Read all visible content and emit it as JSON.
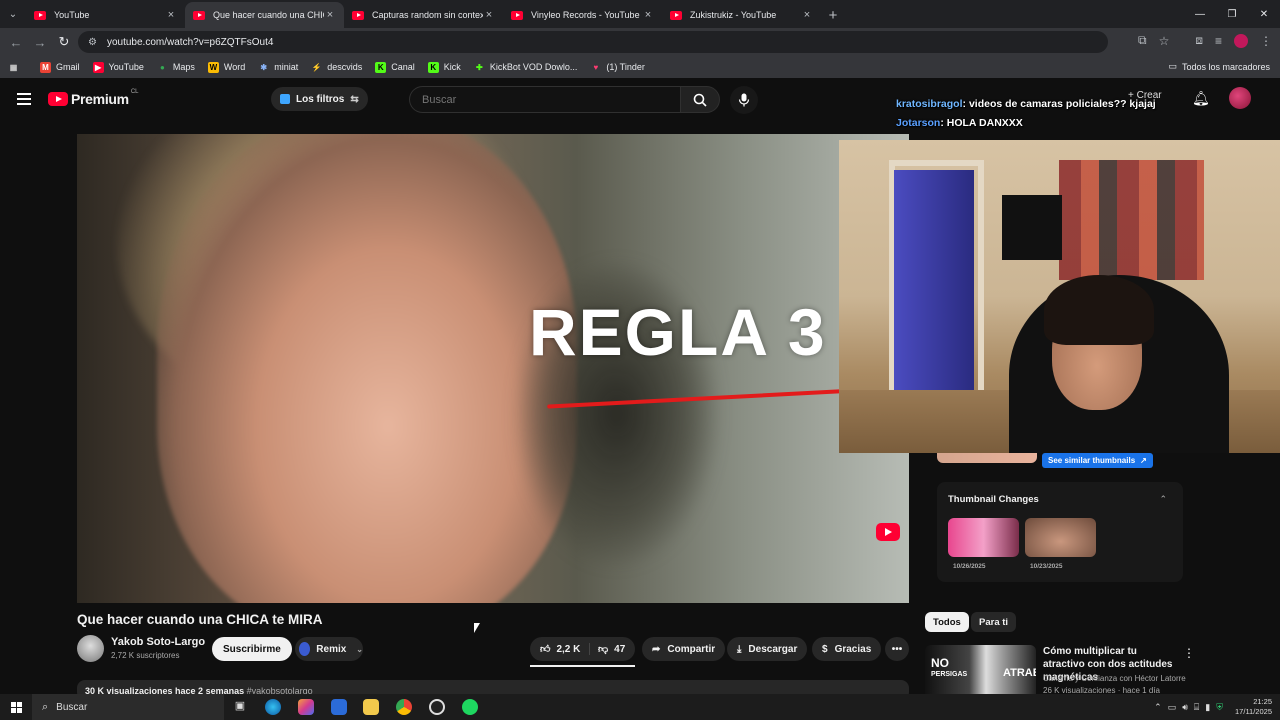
{
  "browser": {
    "tabs": [
      {
        "title": "YouTube",
        "active": false
      },
      {
        "title": "Que hacer cuando una CHICA te",
        "active": true
      },
      {
        "title": "Capturas random sin contexto",
        "active": false
      },
      {
        "title": "Vinyleo Records - YouTube",
        "active": false
      },
      {
        "title": "Zukistrukiz - YouTube",
        "active": false
      }
    ],
    "url": "youtube.com/watch?v=p6ZQTFsOut4",
    "bookmarks": [
      "Gmail",
      "YouTube",
      "Maps",
      "Word",
      "miniat",
      "descvids",
      "Canal",
      "Kick",
      "KickBot VOD Dowlo...",
      "(1) Tinder"
    ],
    "bookmarks_folder": "Todos los marcadores"
  },
  "yt": {
    "logo_text": "Premium",
    "country": "CL",
    "filters_label": "Los filtros",
    "search_placeholder": "Buscar",
    "create_label": "Crear"
  },
  "chat": [
    {
      "user": "kratosibragol",
      "message": ": videos de camaras policiales?? kjajaj"
    },
    {
      "user": "Jotarson",
      "message": ": HOLA DANXXX"
    }
  ],
  "video": {
    "overlay_text": "REGLA 3",
    "title": "Que hacer cuando una CHICA te MIRA",
    "channel": "Yakob Soto-Largo",
    "subscribers": "2,72 K suscriptores",
    "subscribe_label": "Suscribirme",
    "remix_label": "Remix",
    "likes": "2,2 K",
    "dislikes": "47",
    "share_label": "Compartir",
    "download_label": "Descargar",
    "thanks_label": "Gracias",
    "description_stats": "30 K visualizaciones  hace 2 semanas",
    "description_tag": "#yakobsotolargo"
  },
  "thumbnail_tool": {
    "see_similar_label": "See similar thumbnails",
    "changes_title": "Thumbnail Changes",
    "dates": [
      "10/26/2025",
      "10/23/2025"
    ]
  },
  "sidebar": {
    "chips": [
      "Todos",
      "Para ti"
    ],
    "recommendation": {
      "title": "Cómo multiplicar tu atractivo con dos actitudes magnéticas",
      "channel": "Carisma y Confianza con Héctor Latorre",
      "meta": "26 K visualizaciones · hace 1 día",
      "thumb_text_left": "NO",
      "thumb_text_left_small": "PERSIGAS",
      "thumb_text_right": "ATRAE"
    }
  },
  "taskbar": {
    "search_label": "Buscar",
    "time": "21:25",
    "date": "17/11/2025"
  },
  "colors": {
    "yt_red": "#ff0033",
    "accent_blue": "#1a73e8",
    "chat_user": "#6fb6ff"
  }
}
